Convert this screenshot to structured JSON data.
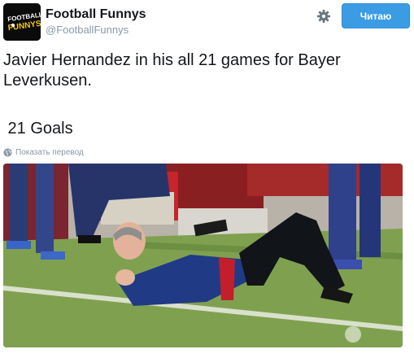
{
  "account": {
    "name": "Football Funnys",
    "handle": "@FootballFunnys",
    "avatar_alt": "FOOTBALL FUNNYS"
  },
  "actions": {
    "follow_label": "Читаю",
    "settings_icon": "gear-icon"
  },
  "tweet": {
    "text": "Javier Hernandez in his all 21 games for Bayer Leverkusen.",
    "goals": " 21 Goals",
    "translate_label": "Показать перевод"
  },
  "colors": {
    "follow_button": "#3b9ce4",
    "muted_text": "#8899a6",
    "text": "#14171a"
  }
}
